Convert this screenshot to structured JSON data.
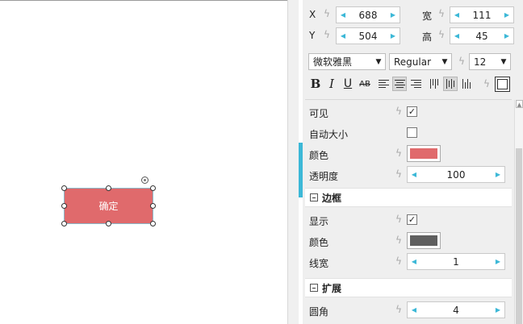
{
  "canvas": {
    "widget_label": "确定",
    "widget_color": "#e06a6c"
  },
  "geometry": {
    "x_label": "X",
    "x_value": "688",
    "w_label": "宽",
    "w_value": "111",
    "y_label": "Y",
    "y_value": "504",
    "h_label": "高",
    "h_value": "45"
  },
  "text_style": {
    "font_family": "微软雅黑",
    "font_weight": "Regular",
    "font_size": "12",
    "bold_label": "B",
    "italic_label": "I",
    "underline_label": "U",
    "strike_label": "AB"
  },
  "props": {
    "visible_label": "可见",
    "autosize_label": "自动大小",
    "color_label": "颜色",
    "fill_color": "#e06a6c",
    "opacity_label": "透明度",
    "opacity_value": "100"
  },
  "border": {
    "title": "边框",
    "show_label": "显示",
    "color_label": "颜色",
    "color": "#5f5f5f",
    "width_label": "线宽",
    "width_value": "1"
  },
  "extend": {
    "title": "扩展",
    "radius_label": "圆角",
    "radius_value": "4"
  },
  "colors": {
    "accent": "#3cb8d7"
  }
}
